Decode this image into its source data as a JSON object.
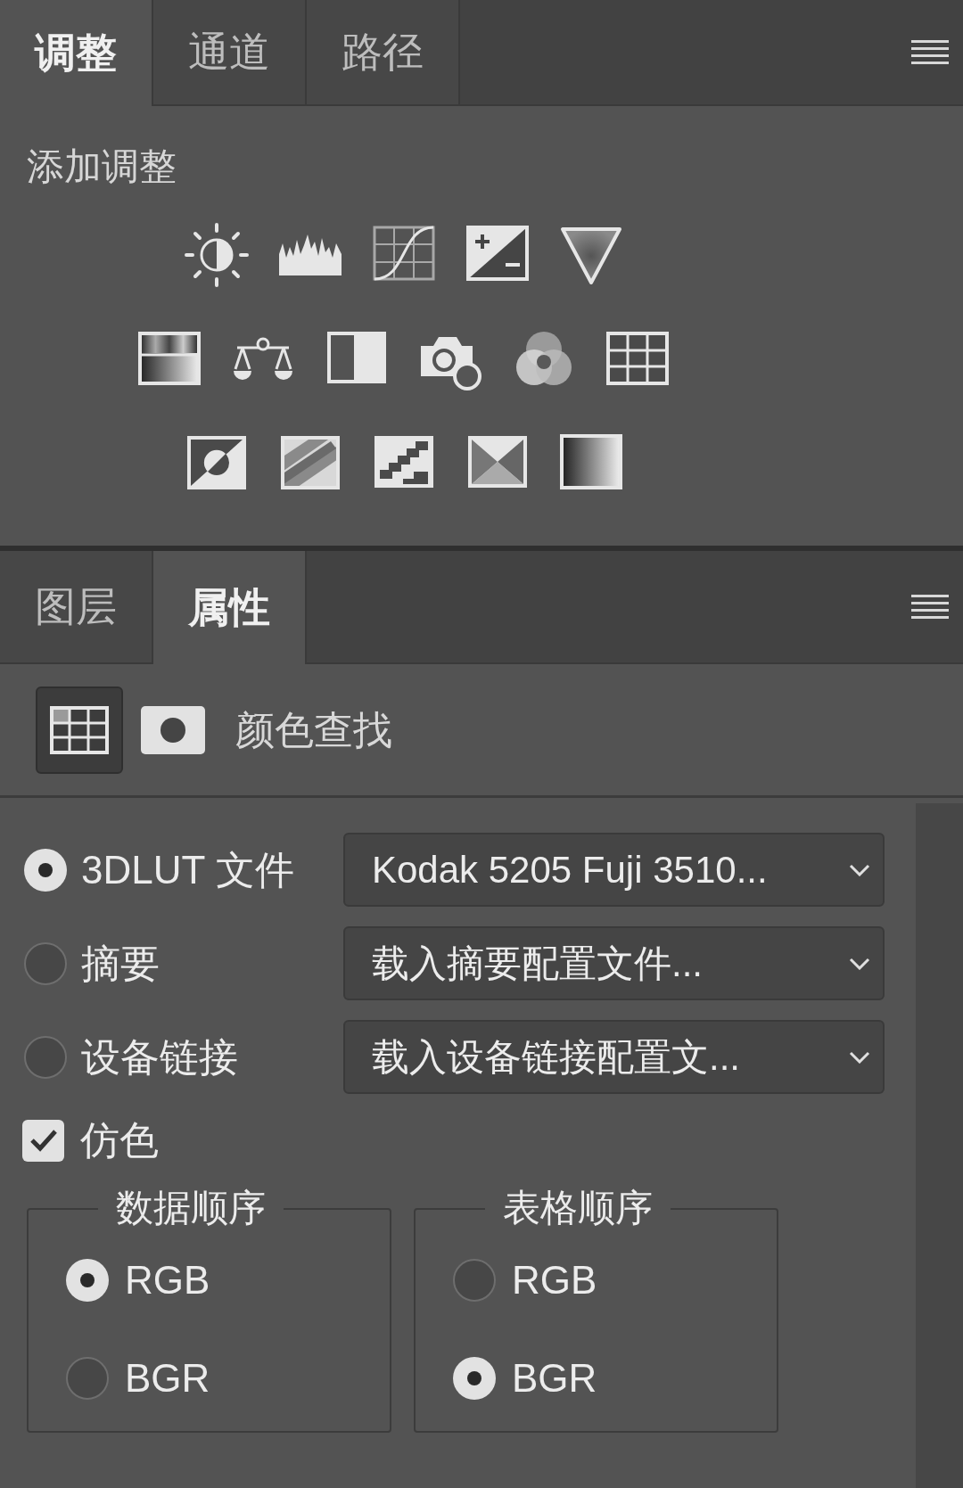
{
  "top_tabs": [
    {
      "label": "调整",
      "selected": true
    },
    {
      "label": "通道",
      "selected": false
    },
    {
      "label": "路径",
      "selected": false
    }
  ],
  "adjustments": {
    "heading": "添加调整"
  },
  "bottom_tabs": [
    {
      "label": "图层",
      "selected": false
    },
    {
      "label": "属性",
      "selected": true
    }
  ],
  "properties": {
    "title": "颜色查找",
    "sources": [
      {
        "label": "3DLUT 文件",
        "selected": true,
        "dropdown": "Kodak 5205 Fuji 3510..."
      },
      {
        "label": "摘要",
        "selected": false,
        "dropdown": "载入摘要配置文件..."
      },
      {
        "label": "设备链接",
        "selected": false,
        "dropdown": "载入设备链接配置文..."
      }
    ],
    "dither": {
      "label": "仿色",
      "checked": true
    },
    "groups": [
      {
        "title": "数据顺序",
        "options": [
          {
            "label": "RGB",
            "selected": true
          },
          {
            "label": "BGR",
            "selected": false
          }
        ]
      },
      {
        "title": "表格顺序",
        "options": [
          {
            "label": "RGB",
            "selected": false
          },
          {
            "label": "BGR",
            "selected": true
          }
        ]
      }
    ]
  }
}
